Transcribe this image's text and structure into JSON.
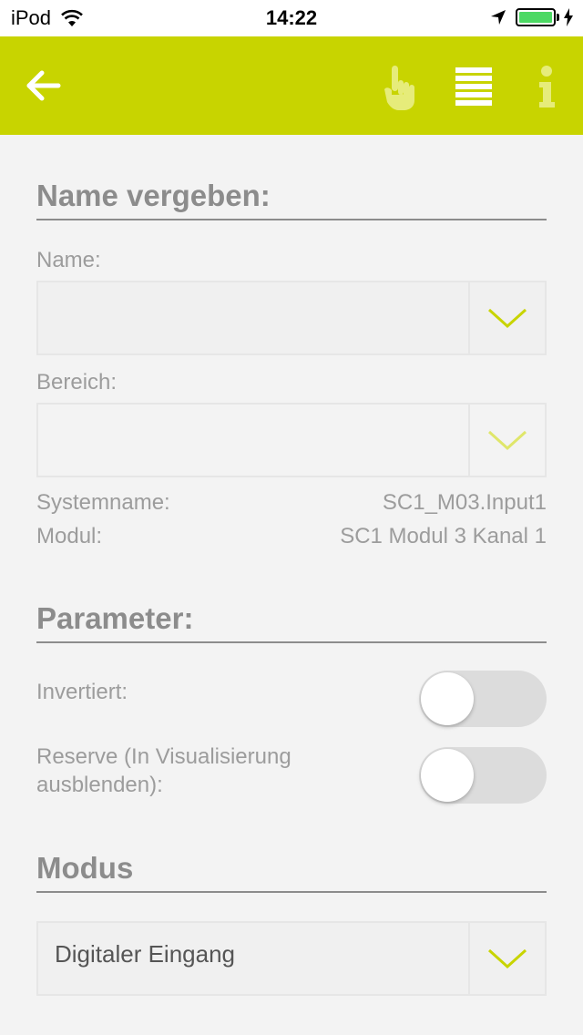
{
  "status_bar": {
    "carrier": "iPod",
    "time": "14:22"
  },
  "app_bar": {
    "accent_color": "#c8d400",
    "icons": [
      "back-arrow-icon",
      "hand-pointer-icon",
      "list-icon",
      "info-icon"
    ]
  },
  "name_section": {
    "title": "Name vergeben:",
    "name_label": "Name:",
    "name_value": "",
    "area_label": "Bereich:",
    "area_value": "",
    "systemname_label": "Systemname:",
    "systemname_value": "SC1_M03.Input1",
    "module_label": "Modul:",
    "module_value": "SC1 Modul 3 Kanal 1"
  },
  "parameter_section": {
    "title": "Parameter:",
    "inverted_label": "Invertiert:",
    "inverted_on": false,
    "reserve_label_line1": "Reserve (In Visualisierung",
    "reserve_label_line2": "ausblenden):",
    "reserve_on": false
  },
  "mode_section": {
    "title": "Modus",
    "selected": "Digitaler Eingang"
  }
}
